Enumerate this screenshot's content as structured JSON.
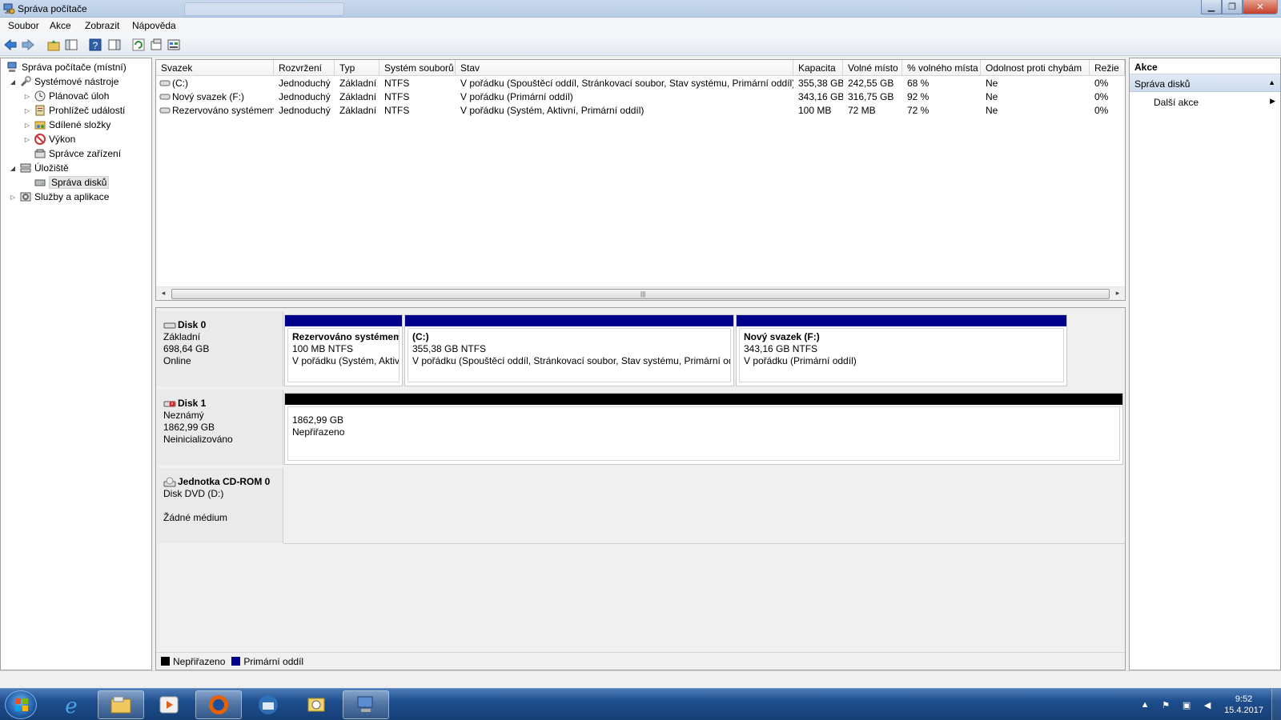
{
  "window": {
    "title": "Správa počítače"
  },
  "menu": [
    "Soubor",
    "Akce",
    "Zobrazit",
    "Nápověda"
  ],
  "tree": {
    "root": "Správa počítače (místní)",
    "system_tools": "Systémové nástroje",
    "task_scheduler": "Plánovač úloh",
    "event_viewer": "Prohlížeč událostí",
    "shared_folders": "Sdílené složky",
    "performance": "Výkon",
    "device_manager": "Správce zařízení",
    "storage": "Úložiště",
    "disk_management": "Správa disků",
    "services": "Služby a aplikace"
  },
  "volume_table": {
    "columns": [
      "Svazek",
      "Rozvržení",
      "Typ",
      "Systém souborů",
      "Stav",
      "Kapacita",
      "Volné místo",
      "% volného místa",
      "Odolnost proti chybám",
      "Režie"
    ],
    "rows": [
      [
        "(C:)",
        "Jednoduchý",
        "Základní",
        "NTFS",
        "V pořádku (Spouštěcí oddíl, Stránkovací soubor, Stav systému, Primární oddíl)",
        "355,38 GB",
        "242,55 GB",
        "68 %",
        "Ne",
        "0%"
      ],
      [
        "Nový svazek (F:)",
        "Jednoduchý",
        "Základní",
        "NTFS",
        "V pořádku (Primární oddíl)",
        "343,16 GB",
        "316,75 GB",
        "92 %",
        "Ne",
        "0%"
      ],
      [
        "Rezervováno systémem",
        "Jednoduchý",
        "Základní",
        "NTFS",
        "V pořádku (Systém, Aktivní, Primární oddíl)",
        "100 MB",
        "72 MB",
        "72 %",
        "Ne",
        "0%"
      ]
    ]
  },
  "disks": {
    "disk0": {
      "name": "Disk 0",
      "type": "Základní",
      "size": "698,64 GB",
      "state": "Online"
    },
    "disk1": {
      "name": "Disk 1",
      "type": "Neznámý",
      "size": "1862,99 GB",
      "state": "Neinicializováno"
    },
    "cdrom": {
      "name": "Jednotka CD-ROM 0",
      "type": "Disk DVD (D:)",
      "state": "Žádné médium"
    }
  },
  "partitions": {
    "p_reserved": {
      "name": "Rezervováno systémem",
      "size": "100 MB NTFS",
      "status": "V pořádku (Systém, Aktiv"
    },
    "p_c": {
      "name": "(C:)",
      "size": "355,38 GB NTFS",
      "status": "V pořádku (Spouštěcí oddíl, Stránkovací soubor, Stav systému, Primární odd"
    },
    "p_f": {
      "name": "Nový svazek  (F:)",
      "size": "343,16 GB NTFS",
      "status": "V pořádku (Primární oddíl)"
    },
    "p_unalloc": {
      "size": "1862,99 GB",
      "status": "Nepřiřazeno"
    }
  },
  "legend": {
    "unallocated": "Nepřiřazeno",
    "primary": "Primární oddíl"
  },
  "actions": {
    "header": "Akce",
    "section": "Správa disků",
    "more": "Další akce"
  },
  "clock": {
    "time": "9:52",
    "date": "15.4.2017"
  },
  "colors": {
    "primary_partition": "#00008b",
    "unallocated": "#000000",
    "selection": "#cddcee"
  }
}
